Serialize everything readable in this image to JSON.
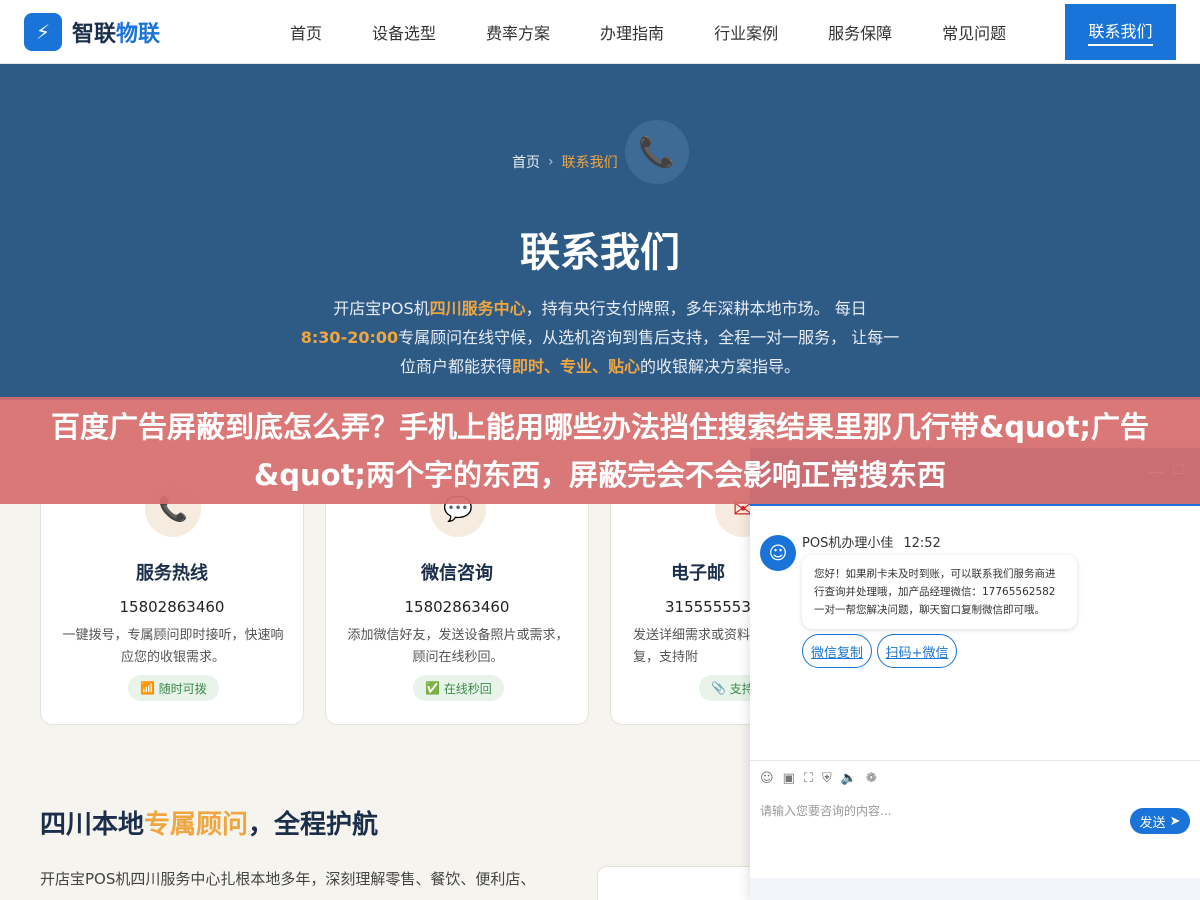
{
  "header": {
    "logo_icon": "lightning-icon",
    "logo_glyph": "⚡",
    "logo_part1": "智联",
    "logo_part2": "物联",
    "nav": [
      "首页",
      "设备选型",
      "费率方案",
      "办理指南",
      "行业案例",
      "服务保障",
      "常见问题"
    ],
    "cta": "联系我们",
    "brand_color": "#1a73d9"
  },
  "hero": {
    "breadcrumb_home": "首页",
    "breadcrumb_sep": "›",
    "breadcrumb_current": "联系我们",
    "phone_icon": "phone-icon",
    "title": "联系我们",
    "desc_1": "开店宝POS机",
    "desc_hl1": "四川服务中心",
    "desc_2": "，持有央行支付牌照，多年深耕本地市场。 每日",
    "desc_hl2": "8:30-20:00",
    "desc_3": "专属顾问在线守候，从选机咨询到售后支持，全程一对一服务， 让每一位商户都能获得",
    "desc_hl3": "即时、专业、贴心",
    "desc_4": "的收银解决方案指导。",
    "background_color": "#2e5a86",
    "highlight_color": "#f0a640"
  },
  "overlay": {
    "text": "百度广告屏蔽到底怎么弄？手机上能用哪些办法挡住搜索结果里那几行带&quot;广告&quot;两个字的东西，屏蔽完会不会影响正常搜东西"
  },
  "cards": [
    {
      "icon": "phone-icon",
      "glyph": "📞",
      "title": "服务热线",
      "number": "15802863460",
      "desc": "一键拨号，专属顾问即时接听，快速响应您的收银需求。",
      "badge_icon": "signal-icon",
      "badge_glyph": "📶",
      "badge": "随时可拨"
    },
    {
      "icon": "chat-icon",
      "glyph": "💬",
      "title": "微信咨询",
      "number": "15802863460",
      "desc": "添加微信好友，发送设备照片或需求，顾问在线秒回。",
      "badge_icon": "check-icon",
      "badge_glyph": "✅",
      "badge": "在线秒回"
    },
    {
      "icon": "mail-icon",
      "glyph": "✉",
      "title": "电子邮",
      "number": "3155555535",
      "desc": "发送详细需求或资料复，支持附",
      "badge_icon": "clip-icon",
      "badge_glyph": "📎",
      "badge": "支持"
    }
  ],
  "section": {
    "title_1": "四川本地",
    "title_hl": "专属顾问",
    "title_2": "，全程护航",
    "text": "开店宝POS机四川服务中心扎根本地多年，深刻理解零售、餐饮、便利店、"
  },
  "chat": {
    "minimize": "—",
    "maximize": "☐",
    "agent_icon": "agent-avatar-icon",
    "agent_glyph": "☺",
    "agent_name": "POS机办理小佳",
    "time": "12:52",
    "message": "您好！如果刷卡未及时到账，可以联系我们服务商进行查询并处理哦，加产品经理微信：17765562582 一对一帮您解决问题，聊天窗口复制微信即可哦。",
    "btn_copy": "微信复制",
    "btn_scan": "扫码+微信",
    "tools": [
      {
        "icon": "emoji-icon",
        "glyph": "☺"
      },
      {
        "icon": "image-icon",
        "glyph": "▣"
      },
      {
        "icon": "screenshot-icon",
        "glyph": "⛶"
      },
      {
        "icon": "shield-icon",
        "glyph": "⛨"
      },
      {
        "icon": "sound-icon",
        "glyph": "🔈"
      },
      {
        "icon": "wechat-icon",
        "glyph": "❁"
      }
    ],
    "placeholder": "请输入您要咨询的内容...",
    "send": "发送",
    "send_glyph": "➤"
  }
}
